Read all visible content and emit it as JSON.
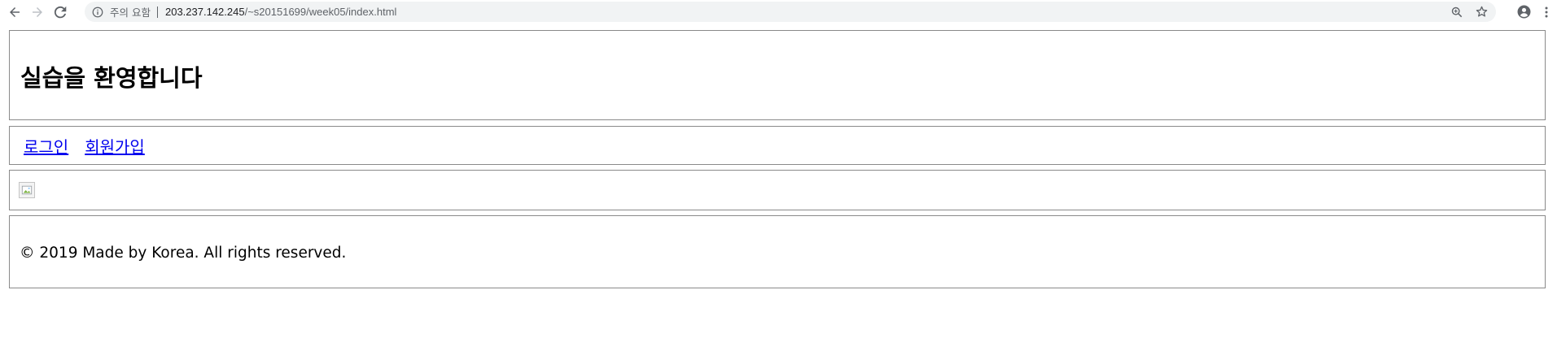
{
  "browser": {
    "security_label": "주의 요함",
    "url_host": "203.237.142.245",
    "url_path": "/~s20151699/week05/index.html",
    "icons": {
      "back": "back-arrow-icon",
      "forward": "forward-arrow-icon",
      "reload": "reload-icon",
      "info": "info-icon",
      "zoom": "zoom-icon",
      "bookmark": "star-icon",
      "profile": "account-icon",
      "menu": "kebab-menu-icon"
    }
  },
  "page": {
    "title": "실습을 환영합니다",
    "nav": {
      "login": "로그인",
      "signup": "회원가입"
    },
    "image_alt": "",
    "footer": "© 2019 Made by Korea. All rights reserved."
  },
  "colors": {
    "link": "#0000ee",
    "border": "#8a8a8a",
    "omnibox_bg": "#f1f3f4"
  }
}
